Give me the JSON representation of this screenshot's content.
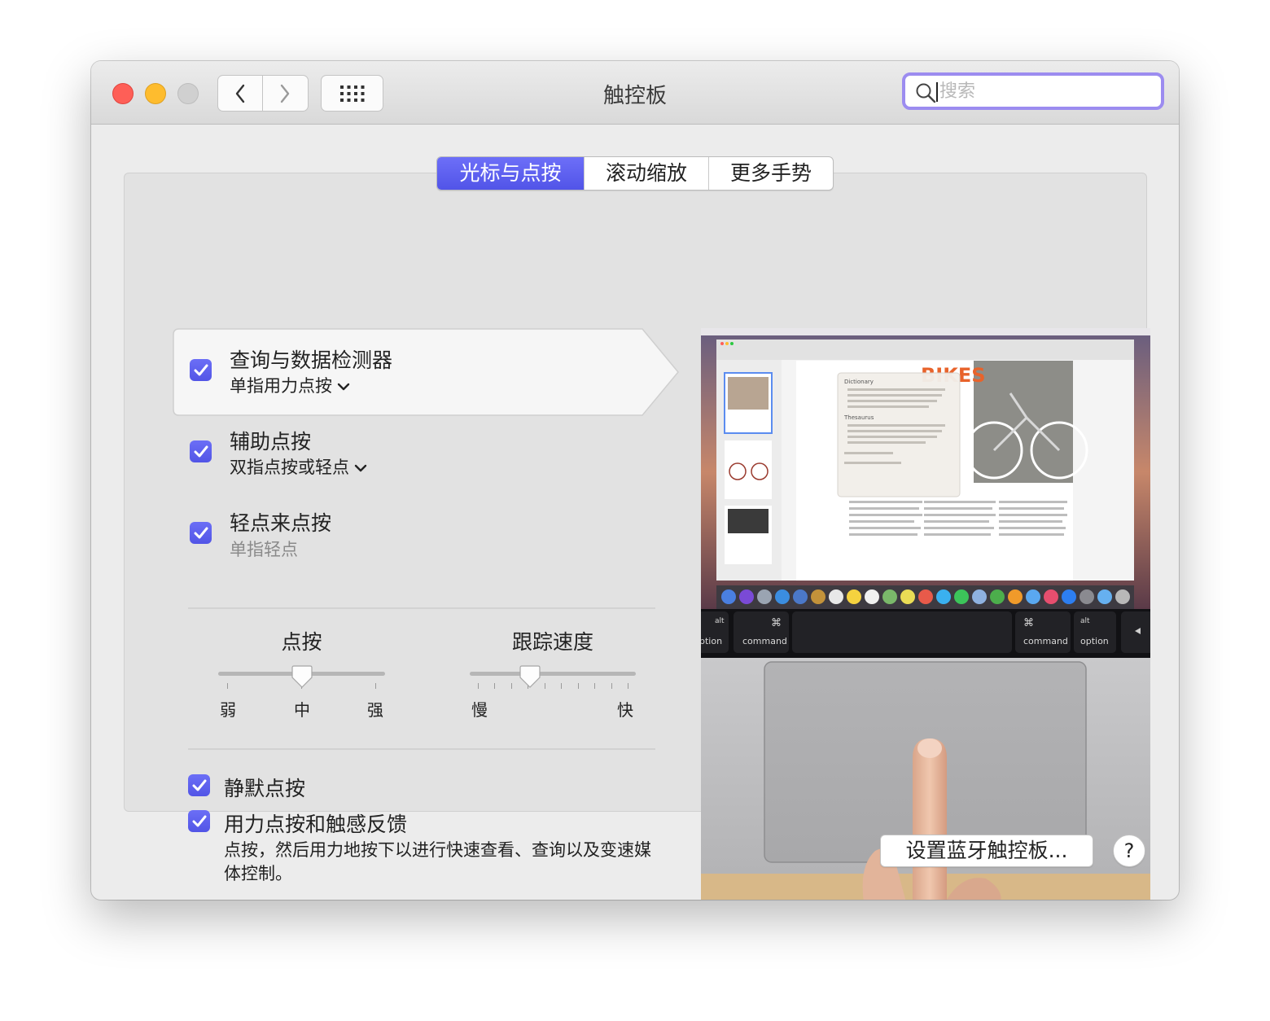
{
  "window": {
    "title": "触控板"
  },
  "search": {
    "placeholder": "搜索"
  },
  "tabs": [
    {
      "label": "光标与点按",
      "active": true
    },
    {
      "label": "滚动缩放",
      "active": false
    },
    {
      "label": "更多手势",
      "active": false
    }
  ],
  "options": [
    {
      "label": "查询与数据检测器",
      "sub": "单指用力点按",
      "checked": true,
      "selected": true
    },
    {
      "label": "辅助点按",
      "sub": "双指点按或轻点",
      "checked": true
    },
    {
      "label": "轻点来点按",
      "sub": "单指轻点",
      "checked": true
    }
  ],
  "sliders": {
    "click": {
      "label": "点按",
      "ticks": [
        "弱",
        "中",
        "强"
      ],
      "value": "中"
    },
    "tracking": {
      "label": "跟踪速度",
      "min_label": "慢",
      "max_label": "快",
      "value_fraction": 0.35
    }
  },
  "bottom_options": {
    "silent_click": {
      "label": "静默点按",
      "checked": true
    },
    "force_click": {
      "label": "用力点按和触感反馈",
      "description": "点按，然后用力地按下以进行快速查看、查询以及变速媒体控制。",
      "checked": true
    }
  },
  "preview": {
    "keys": {
      "alt": "alt",
      "option": "option",
      "command": "command",
      "cmd_symbol": "⌘",
      "option_partial": "ption"
    },
    "doc_heading": "BIKES",
    "popover": {
      "dictionary": "Dictionary",
      "thesaurus": "Thesaurus"
    }
  },
  "footer": {
    "bluetooth_button": "设置蓝牙触控板...",
    "help": "?"
  },
  "colors": {
    "accent": "#5a5cf0",
    "search_focus": "#9c8cf0"
  }
}
